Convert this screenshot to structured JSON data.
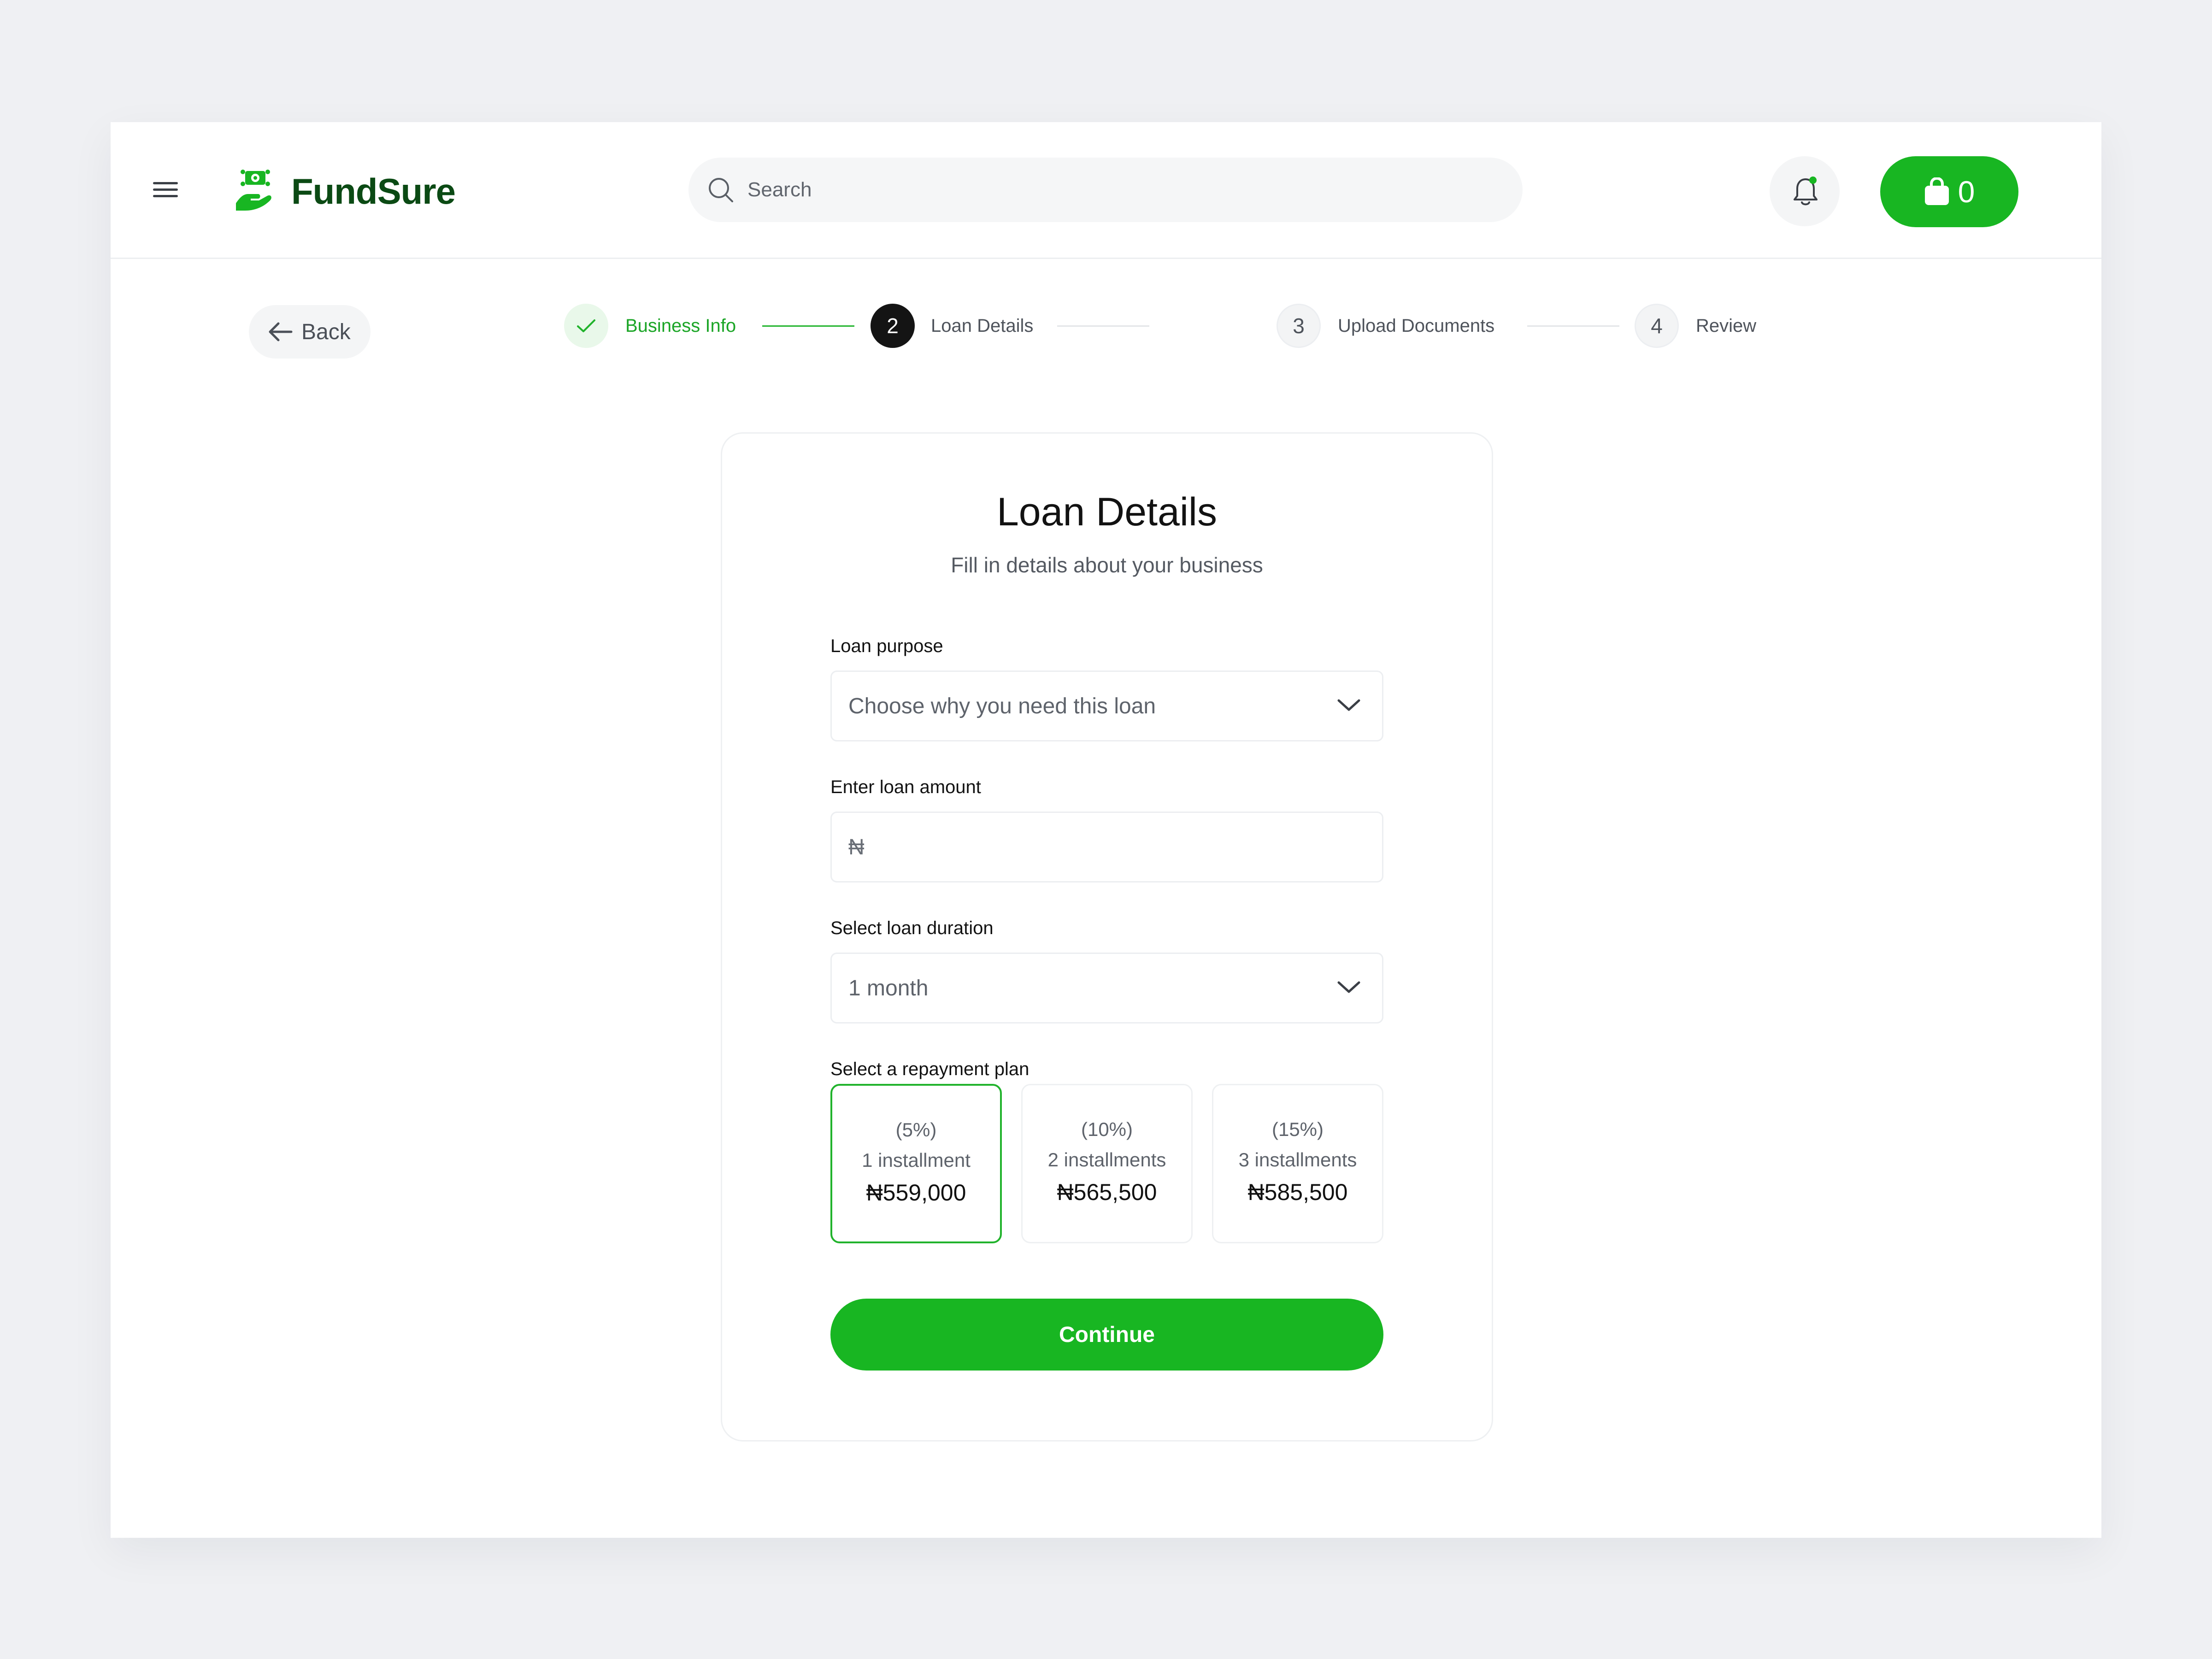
{
  "brand": {
    "name": "FundSure",
    "accent": "#18b622",
    "dark": "#0b4a14"
  },
  "header": {
    "search_placeholder": "Search",
    "cart_count": "0",
    "menu_icon": "hamburger-icon",
    "bell_icon": "bell-icon",
    "cart_icon": "shopping-bag-icon"
  },
  "nav": {
    "back_label": "Back"
  },
  "stepper": {
    "steps": [
      {
        "number": "",
        "label": "Business Info",
        "state": "completed"
      },
      {
        "number": "2",
        "label": "Loan Details",
        "state": "active"
      },
      {
        "number": "3",
        "label": "Upload Documents",
        "state": "upcoming"
      },
      {
        "number": "4",
        "label": "Review",
        "state": "upcoming"
      }
    ]
  },
  "form": {
    "title": "Loan Details",
    "subtitle": "Fill in details about your business",
    "purpose": {
      "label": "Loan purpose",
      "value": "Choose why you need this loan"
    },
    "amount": {
      "label": "Enter loan amount",
      "placeholder": "₦"
    },
    "duration": {
      "label": "Select loan duration",
      "value": "1 month"
    },
    "plan_label": "Select a repayment plan",
    "plans": [
      {
        "percent": "(5%)",
        "installments": "1 installment",
        "amount": "₦559,000",
        "selected": true
      },
      {
        "percent": "(10%)",
        "installments": "2 installments",
        "amount": "₦565,500",
        "selected": false
      },
      {
        "percent": "(15%)",
        "installments": "3 installments",
        "amount": "₦585,500",
        "selected": false
      }
    ],
    "continue_label": "Continue"
  }
}
